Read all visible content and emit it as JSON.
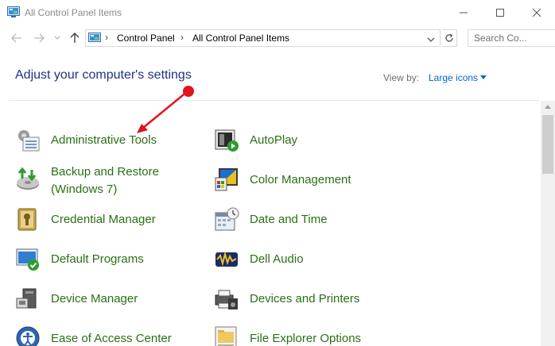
{
  "window": {
    "title": "All Control Panel Items"
  },
  "address_bar": {
    "crumbs": [
      "Control Panel",
      "All Control Panel Items"
    ]
  },
  "search": {
    "placeholder": "Search Co..."
  },
  "header": {
    "title": "Adjust your computer's settings",
    "view_by_label": "View by:",
    "view_by_value": "Large icons"
  },
  "items": [
    {
      "label": "Administrative Tools",
      "icon": "administrative-tools-icon"
    },
    {
      "label": "AutoPlay",
      "icon": "autoplay-icon"
    },
    {
      "label": "Backup and Restore",
      "label2": "(Windows 7)",
      "icon": "backup-restore-icon"
    },
    {
      "label": "Color Management",
      "icon": "color-management-icon"
    },
    {
      "label": "Credential Manager",
      "icon": "credential-manager-icon"
    },
    {
      "label": "Date and Time",
      "icon": "date-time-icon"
    },
    {
      "label": "Default Programs",
      "icon": "default-programs-icon"
    },
    {
      "label": "Dell Audio",
      "icon": "dell-audio-icon"
    },
    {
      "label": "Device Manager",
      "icon": "device-manager-icon"
    },
    {
      "label": "Devices and Printers",
      "icon": "devices-printers-icon"
    },
    {
      "label": "Ease of Access Center",
      "icon": "ease-of-access-icon"
    },
    {
      "label": "File Explorer Options",
      "icon": "file-explorer-options-icon"
    }
  ],
  "colors": {
    "link_green": "#2b6f16",
    "heading_blue": "#1e3287",
    "accent_blue": "#0066cc",
    "annotation_red": "#e0141e"
  }
}
